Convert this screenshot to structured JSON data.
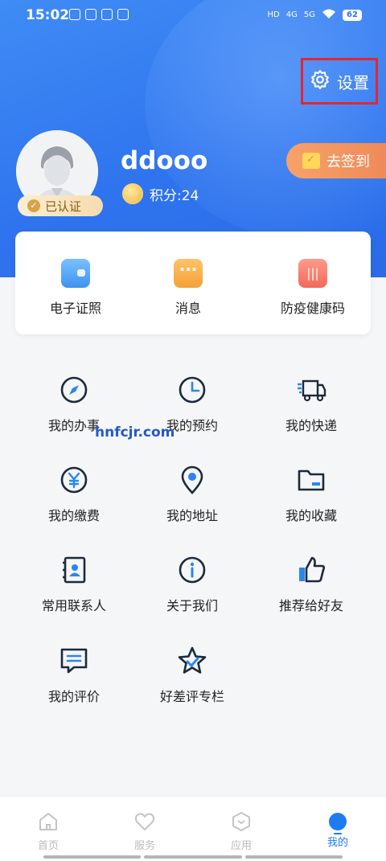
{
  "status_bar": {
    "time": "15:02",
    "battery": "62",
    "net1": "4G",
    "net2": "5G",
    "hd": "HD"
  },
  "header": {
    "settings_label": "设置"
  },
  "profile": {
    "username": "ddooo",
    "points_label": "积分:24",
    "verified_label": "已认证",
    "checkin_label": "去签到"
  },
  "quick_card": {
    "items": [
      {
        "label": "电子证照",
        "icon": "wallet-icon"
      },
      {
        "label": "消息",
        "icon": "message-icon"
      },
      {
        "label": "防疫健康码",
        "icon": "health-code-icon"
      }
    ]
  },
  "menu": {
    "items": [
      {
        "label": "我的办事",
        "icon": "compass-icon"
      },
      {
        "label": "我的预约",
        "icon": "clock-icon"
      },
      {
        "label": "我的快递",
        "icon": "truck-icon"
      },
      {
        "label": "我的缴费",
        "icon": "yen-icon"
      },
      {
        "label": "我的地址",
        "icon": "location-pin-icon"
      },
      {
        "label": "我的收藏",
        "icon": "folder-icon"
      },
      {
        "label": "常用联系人",
        "icon": "contact-book-icon"
      },
      {
        "label": "关于我们",
        "icon": "info-icon"
      },
      {
        "label": "推荐给好友",
        "icon": "thumbs-up-icon"
      },
      {
        "label": "我的评价",
        "icon": "comment-icon"
      },
      {
        "label": "好差评专栏",
        "icon": "star-icon"
      }
    ]
  },
  "watermark": "hnfcjr.com",
  "tabbar": {
    "tabs": [
      {
        "label": "首页",
        "icon": "home-icon",
        "active": false
      },
      {
        "label": "服务",
        "icon": "heart-icon",
        "active": false
      },
      {
        "label": "应用",
        "icon": "hexagon-icon",
        "active": false
      },
      {
        "label": "我的",
        "icon": "user-dot-icon",
        "active": true
      }
    ]
  },
  "colors": {
    "primary": "#2f74ee",
    "accent": "#1f7bf2",
    "checkin": "#f08a58",
    "highlight_border": "#e5262f"
  }
}
